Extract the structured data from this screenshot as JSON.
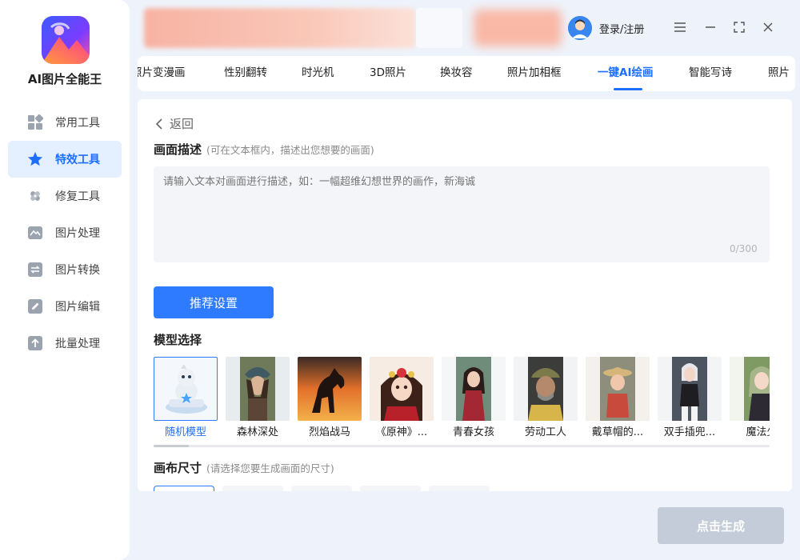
{
  "app": {
    "name": "AI图片全能王"
  },
  "sidebar": {
    "items": [
      {
        "label": "常用工具",
        "icon": "grid-icon",
        "active": false
      },
      {
        "label": "特效工具",
        "icon": "star-icon",
        "active": true
      },
      {
        "label": "修复工具",
        "icon": "bandage-icon",
        "active": false
      },
      {
        "label": "图片处理",
        "icon": "image-icon",
        "active": false
      },
      {
        "label": "图片转换",
        "icon": "convert-icon",
        "active": false
      },
      {
        "label": "图片编辑",
        "icon": "edit-icon",
        "active": false
      },
      {
        "label": "批量处理",
        "icon": "upload-icon",
        "active": false
      }
    ]
  },
  "header": {
    "login_label": "登录/注册"
  },
  "tabs": [
    {
      "label": "照片变漫画",
      "active": false
    },
    {
      "label": "性别翻转",
      "active": false
    },
    {
      "label": "时光机",
      "active": false
    },
    {
      "label": "3D照片",
      "active": false
    },
    {
      "label": "换妆容",
      "active": false
    },
    {
      "label": "照片加相框",
      "active": false
    },
    {
      "label": "一键AI绘画",
      "active": true
    },
    {
      "label": "智能写诗",
      "active": false
    },
    {
      "label": "照片",
      "active": false
    }
  ],
  "panel": {
    "back_label": "返回",
    "description": {
      "title": "画面描述",
      "hint": "(可在文本框内，描述出您想要的画面)",
      "placeholder": "请输入文本对画面进行描述，如：一幅超维幻想世界的画作，新海诚",
      "counter": "0/300"
    },
    "recommend_label": "推荐设置",
    "model_section": {
      "title": "模型选择",
      "models": [
        {
          "label": "随机模型",
          "selected": true
        },
        {
          "label": "森林深处",
          "selected": false
        },
        {
          "label": "烈焰战马",
          "selected": false
        },
        {
          "label": "《原神》...",
          "selected": false
        },
        {
          "label": "青春女孩",
          "selected": false
        },
        {
          "label": "劳动工人",
          "selected": false
        },
        {
          "label": "戴草帽的...",
          "selected": false
        },
        {
          "label": "双手插兜...",
          "selected": false
        },
        {
          "label": "魔法少",
          "selected": false
        }
      ]
    },
    "canvas_section": {
      "title": "画布尺寸",
      "hint": "(请选择您要生成画面的尺寸)"
    }
  },
  "footer": {
    "generate_label": "点击生成"
  },
  "colors": {
    "accent": "#1f6fff",
    "button": "#2f7bff",
    "disabled": "#c3ccd8"
  }
}
